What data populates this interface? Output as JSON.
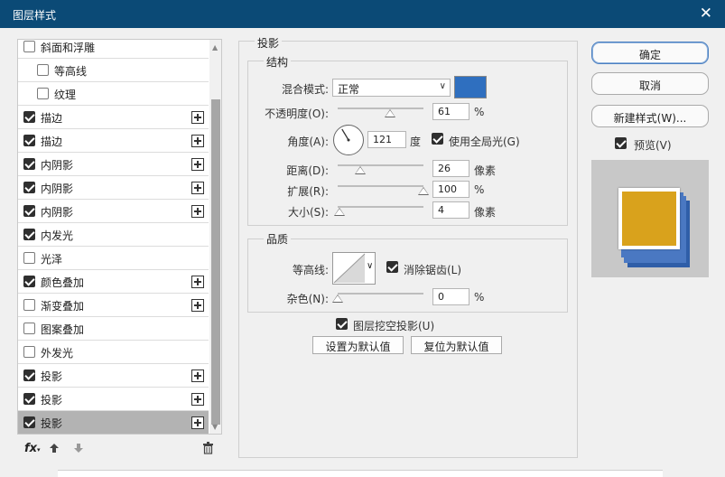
{
  "window": {
    "title": "图层样式",
    "close_glyph": "✕"
  },
  "effects_list": [
    {
      "label": "斜面和浮雕",
      "checked": false,
      "indent": 0,
      "plus": false,
      "selected": false
    },
    {
      "label": "等高线",
      "checked": false,
      "indent": 1,
      "plus": false,
      "selected": false
    },
    {
      "label": "纹理",
      "checked": false,
      "indent": 1,
      "plus": false,
      "selected": false
    },
    {
      "label": "描边",
      "checked": true,
      "indent": 0,
      "plus": true,
      "selected": false
    },
    {
      "label": "描边",
      "checked": true,
      "indent": 0,
      "plus": true,
      "selected": false
    },
    {
      "label": "内阴影",
      "checked": true,
      "indent": 0,
      "plus": true,
      "selected": false
    },
    {
      "label": "内阴影",
      "checked": true,
      "indent": 0,
      "plus": true,
      "selected": false
    },
    {
      "label": "内阴影",
      "checked": true,
      "indent": 0,
      "plus": true,
      "selected": false
    },
    {
      "label": "内发光",
      "checked": true,
      "indent": 0,
      "plus": false,
      "selected": false
    },
    {
      "label": "光泽",
      "checked": false,
      "indent": 0,
      "plus": false,
      "selected": false
    },
    {
      "label": "颜色叠加",
      "checked": true,
      "indent": 0,
      "plus": true,
      "selected": false
    },
    {
      "label": "渐变叠加",
      "checked": false,
      "indent": 0,
      "plus": true,
      "selected": false
    },
    {
      "label": "图案叠加",
      "checked": false,
      "indent": 0,
      "plus": false,
      "selected": false
    },
    {
      "label": "外发光",
      "checked": false,
      "indent": 0,
      "plus": false,
      "selected": false
    },
    {
      "label": "投影",
      "checked": true,
      "indent": 0,
      "plus": true,
      "selected": false
    },
    {
      "label": "投影",
      "checked": true,
      "indent": 0,
      "plus": true,
      "selected": false
    },
    {
      "label": "投影",
      "checked": true,
      "indent": 0,
      "plus": true,
      "selected": true
    }
  ],
  "toolbar": {
    "fx": "fx",
    "up_icon": "arrow-up-icon",
    "down_icon": "arrow-down-icon",
    "trash_icon": "trash-icon"
  },
  "panel": {
    "title": "投影",
    "structure": {
      "title": "结构",
      "blend_mode_label": "混合模式:",
      "blend_mode_value": "正常",
      "color": "#2f6fbf",
      "opacity_label": "不透明度(O):",
      "opacity_value": "61",
      "opacity_unit": "%",
      "opacity_level": 61,
      "angle_label": "角度(A):",
      "angle_value": "121",
      "angle_unit": "度",
      "global_light_label": "使用全局光(G)",
      "global_light_checked": true,
      "distance_label": "距离(D):",
      "distance_value": "26",
      "distance_unit": "像素",
      "distance_level": 0.26,
      "spread_label": "扩展(R):",
      "spread_value": "100",
      "spread_unit": "%",
      "spread_level": 1.0,
      "size_label": "大小(S):",
      "size_value": "4",
      "size_unit": "像素",
      "size_level": 0.02
    },
    "quality": {
      "title": "品质",
      "contour_label": "等高线:",
      "antialias_label": "消除锯齿(L)",
      "antialias_checked": true,
      "noise_label": "杂色(N):",
      "noise_value": "0",
      "noise_unit": "%",
      "noise_level": 0
    },
    "knockout_label": "图层挖空投影(U)",
    "knockout_checked": true,
    "set_default_label": "设置为默认值",
    "reset_default_label": "复位为默认值"
  },
  "buttons": {
    "ok": "确定",
    "cancel": "取消",
    "new_style": "新建样式(W)...",
    "preview_label": "预览(V)",
    "preview_checked": true
  },
  "preview_colors": {
    "fill": "#d9a21c",
    "shadow": "#4a78c2",
    "shadow_dark": "#2f5ea8"
  }
}
